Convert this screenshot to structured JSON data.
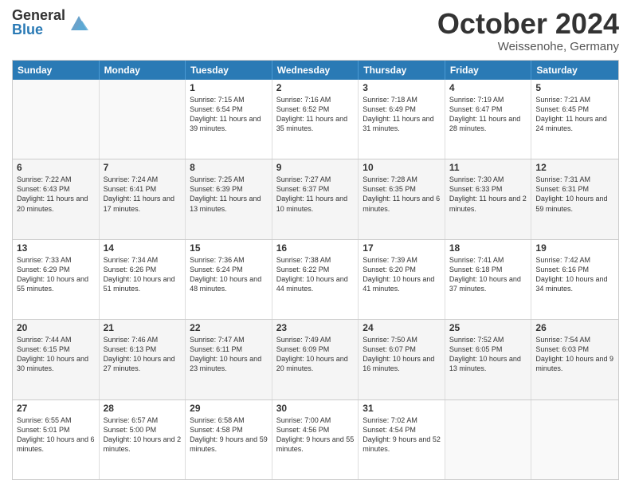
{
  "logo": {
    "general": "General",
    "blue": "Blue"
  },
  "title": "October 2024",
  "location": "Weissenohe, Germany",
  "days": [
    "Sunday",
    "Monday",
    "Tuesday",
    "Wednesday",
    "Thursday",
    "Friday",
    "Saturday"
  ],
  "weeks": [
    [
      {
        "day": "",
        "sunrise": "",
        "sunset": "",
        "daylight": ""
      },
      {
        "day": "",
        "sunrise": "",
        "sunset": "",
        "daylight": ""
      },
      {
        "day": "1",
        "sunrise": "Sunrise: 7:15 AM",
        "sunset": "Sunset: 6:54 PM",
        "daylight": "Daylight: 11 hours and 39 minutes."
      },
      {
        "day": "2",
        "sunrise": "Sunrise: 7:16 AM",
        "sunset": "Sunset: 6:52 PM",
        "daylight": "Daylight: 11 hours and 35 minutes."
      },
      {
        "day": "3",
        "sunrise": "Sunrise: 7:18 AM",
        "sunset": "Sunset: 6:49 PM",
        "daylight": "Daylight: 11 hours and 31 minutes."
      },
      {
        "day": "4",
        "sunrise": "Sunrise: 7:19 AM",
        "sunset": "Sunset: 6:47 PM",
        "daylight": "Daylight: 11 hours and 28 minutes."
      },
      {
        "day": "5",
        "sunrise": "Sunrise: 7:21 AM",
        "sunset": "Sunset: 6:45 PM",
        "daylight": "Daylight: 11 hours and 24 minutes."
      }
    ],
    [
      {
        "day": "6",
        "sunrise": "Sunrise: 7:22 AM",
        "sunset": "Sunset: 6:43 PM",
        "daylight": "Daylight: 11 hours and 20 minutes."
      },
      {
        "day": "7",
        "sunrise": "Sunrise: 7:24 AM",
        "sunset": "Sunset: 6:41 PM",
        "daylight": "Daylight: 11 hours and 17 minutes."
      },
      {
        "day": "8",
        "sunrise": "Sunrise: 7:25 AM",
        "sunset": "Sunset: 6:39 PM",
        "daylight": "Daylight: 11 hours and 13 minutes."
      },
      {
        "day": "9",
        "sunrise": "Sunrise: 7:27 AM",
        "sunset": "Sunset: 6:37 PM",
        "daylight": "Daylight: 11 hours and 10 minutes."
      },
      {
        "day": "10",
        "sunrise": "Sunrise: 7:28 AM",
        "sunset": "Sunset: 6:35 PM",
        "daylight": "Daylight: 11 hours and 6 minutes."
      },
      {
        "day": "11",
        "sunrise": "Sunrise: 7:30 AM",
        "sunset": "Sunset: 6:33 PM",
        "daylight": "Daylight: 11 hours and 2 minutes."
      },
      {
        "day": "12",
        "sunrise": "Sunrise: 7:31 AM",
        "sunset": "Sunset: 6:31 PM",
        "daylight": "Daylight: 10 hours and 59 minutes."
      }
    ],
    [
      {
        "day": "13",
        "sunrise": "Sunrise: 7:33 AM",
        "sunset": "Sunset: 6:29 PM",
        "daylight": "Daylight: 10 hours and 55 minutes."
      },
      {
        "day": "14",
        "sunrise": "Sunrise: 7:34 AM",
        "sunset": "Sunset: 6:26 PM",
        "daylight": "Daylight: 10 hours and 51 minutes."
      },
      {
        "day": "15",
        "sunrise": "Sunrise: 7:36 AM",
        "sunset": "Sunset: 6:24 PM",
        "daylight": "Daylight: 10 hours and 48 minutes."
      },
      {
        "day": "16",
        "sunrise": "Sunrise: 7:38 AM",
        "sunset": "Sunset: 6:22 PM",
        "daylight": "Daylight: 10 hours and 44 minutes."
      },
      {
        "day": "17",
        "sunrise": "Sunrise: 7:39 AM",
        "sunset": "Sunset: 6:20 PM",
        "daylight": "Daylight: 10 hours and 41 minutes."
      },
      {
        "day": "18",
        "sunrise": "Sunrise: 7:41 AM",
        "sunset": "Sunset: 6:18 PM",
        "daylight": "Daylight: 10 hours and 37 minutes."
      },
      {
        "day": "19",
        "sunrise": "Sunrise: 7:42 AM",
        "sunset": "Sunset: 6:16 PM",
        "daylight": "Daylight: 10 hours and 34 minutes."
      }
    ],
    [
      {
        "day": "20",
        "sunrise": "Sunrise: 7:44 AM",
        "sunset": "Sunset: 6:15 PM",
        "daylight": "Daylight: 10 hours and 30 minutes."
      },
      {
        "day": "21",
        "sunrise": "Sunrise: 7:46 AM",
        "sunset": "Sunset: 6:13 PM",
        "daylight": "Daylight: 10 hours and 27 minutes."
      },
      {
        "day": "22",
        "sunrise": "Sunrise: 7:47 AM",
        "sunset": "Sunset: 6:11 PM",
        "daylight": "Daylight: 10 hours and 23 minutes."
      },
      {
        "day": "23",
        "sunrise": "Sunrise: 7:49 AM",
        "sunset": "Sunset: 6:09 PM",
        "daylight": "Daylight: 10 hours and 20 minutes."
      },
      {
        "day": "24",
        "sunrise": "Sunrise: 7:50 AM",
        "sunset": "Sunset: 6:07 PM",
        "daylight": "Daylight: 10 hours and 16 minutes."
      },
      {
        "day": "25",
        "sunrise": "Sunrise: 7:52 AM",
        "sunset": "Sunset: 6:05 PM",
        "daylight": "Daylight: 10 hours and 13 minutes."
      },
      {
        "day": "26",
        "sunrise": "Sunrise: 7:54 AM",
        "sunset": "Sunset: 6:03 PM",
        "daylight": "Daylight: 10 hours and 9 minutes."
      }
    ],
    [
      {
        "day": "27",
        "sunrise": "Sunrise: 6:55 AM",
        "sunset": "Sunset: 5:01 PM",
        "daylight": "Daylight: 10 hours and 6 minutes."
      },
      {
        "day": "28",
        "sunrise": "Sunrise: 6:57 AM",
        "sunset": "Sunset: 5:00 PM",
        "daylight": "Daylight: 10 hours and 2 minutes."
      },
      {
        "day": "29",
        "sunrise": "Sunrise: 6:58 AM",
        "sunset": "Sunset: 4:58 PM",
        "daylight": "Daylight: 9 hours and 59 minutes."
      },
      {
        "day": "30",
        "sunrise": "Sunrise: 7:00 AM",
        "sunset": "Sunset: 4:56 PM",
        "daylight": "Daylight: 9 hours and 55 minutes."
      },
      {
        "day": "31",
        "sunrise": "Sunrise: 7:02 AM",
        "sunset": "Sunset: 4:54 PM",
        "daylight": "Daylight: 9 hours and 52 minutes."
      },
      {
        "day": "",
        "sunrise": "",
        "sunset": "",
        "daylight": ""
      },
      {
        "day": "",
        "sunrise": "",
        "sunset": "",
        "daylight": ""
      }
    ]
  ]
}
